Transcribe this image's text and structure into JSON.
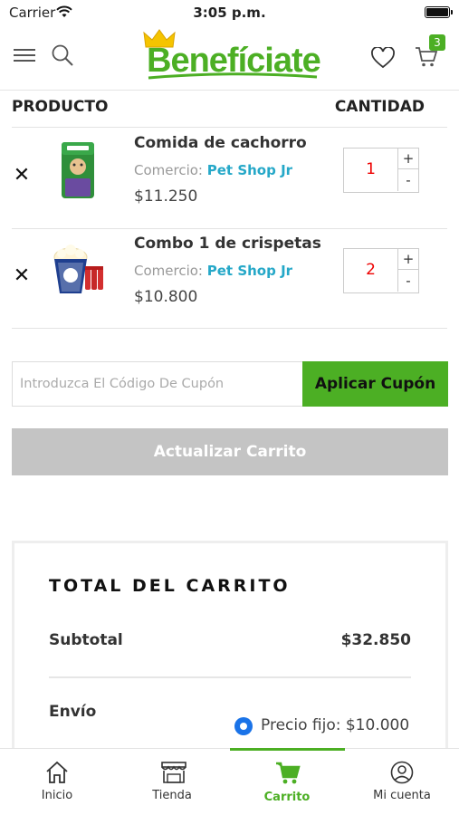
{
  "status_bar": {
    "carrier": "Carrier",
    "time": "3:05 p.m."
  },
  "header": {
    "logo_text": "Benefíciate",
    "cart_count": "3",
    "icons": [
      "menu-icon",
      "search-icon",
      "heart-icon",
      "cart-icon"
    ]
  },
  "table_header": {
    "product": "PRODUCTO",
    "quantity": "CANTIDAD"
  },
  "cart_items": [
    {
      "name": "Comida de cachorro",
      "shop_label": "Comercio:",
      "shop_name": "Pet Shop Jr",
      "price": "$11.250",
      "quantity": "1",
      "remove": "✕",
      "plus": "+",
      "minus": "-"
    },
    {
      "name": "Combo 1 de crispetas",
      "shop_label": "Comercio:",
      "shop_name": "Pet Shop Jr",
      "price": "$10.800",
      "quantity": "2",
      "remove": "✕",
      "plus": "+",
      "minus": "-"
    }
  ],
  "coupon": {
    "placeholder": "Introduzca El Código De Cupón",
    "apply_label": "Aplicar Cupón"
  },
  "update_cart_label": "Actualizar Carrito",
  "totals": {
    "title": "TOTAL DEL CARRITO",
    "subtotal_label": "Subtotal",
    "subtotal_value": "$32.850",
    "shipping_label": "Envío",
    "shipping_option": "Precio fijo: $10.000"
  },
  "tabbar": {
    "items": [
      {
        "label": "Inicio",
        "icon": "home-icon"
      },
      {
        "label": "Tienda",
        "icon": "store-icon"
      },
      {
        "label": "Carrito",
        "icon": "cart-icon"
      },
      {
        "label": "Mi cuenta",
        "icon": "account-icon"
      }
    ],
    "active": "Carrito"
  },
  "colors": {
    "brand_green": "#4caf24",
    "link_blue": "#26a8c8",
    "quantity_red": "#e00000",
    "radio_blue": "#1a73e8",
    "disabled_gray": "#c4c4c4"
  }
}
